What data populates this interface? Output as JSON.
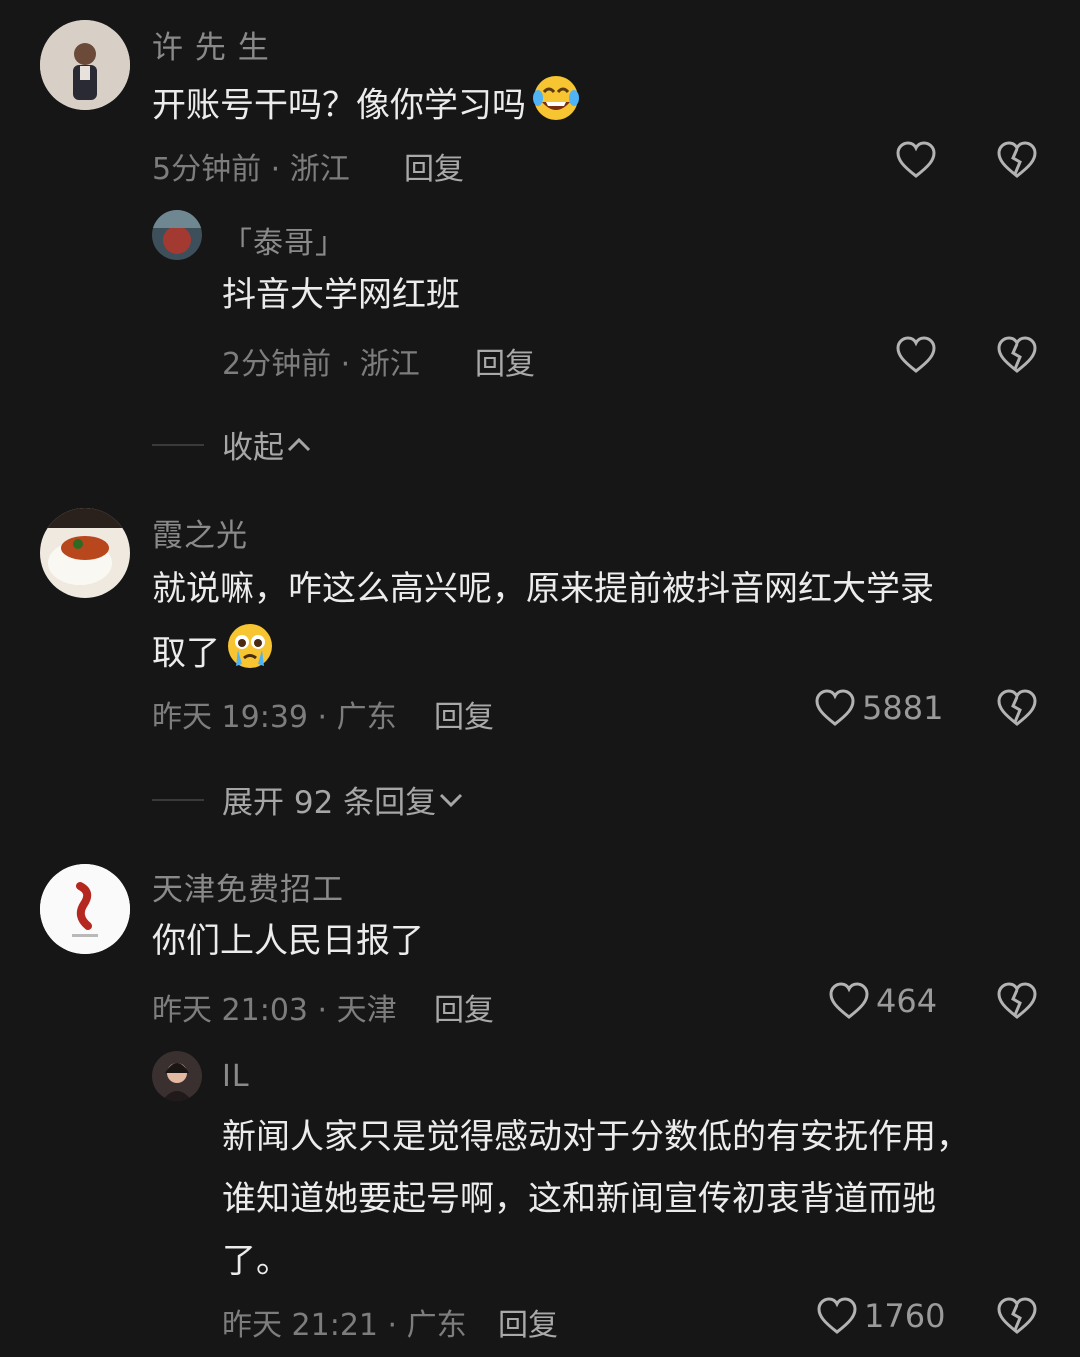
{
  "comments": [
    {
      "user": "许 先 生",
      "text": "开账号干吗？像你学习吗",
      "emoji": "laughing-tears-emoji",
      "time_loc": "5分钟前 · 浙江",
      "reply_label": "回复",
      "likes": "",
      "replies": [
        {
          "user": "「泰哥」",
          "text": "抖音大学网红班",
          "time_loc": "2分钟前 · 浙江",
          "reply_label": "回复"
        }
      ],
      "expand_label": "收起"
    },
    {
      "user": "霞之光",
      "text_line1": "就说嘛，咋这么高兴呢，原来提前被抖音网红大学录",
      "text_line2": "取了",
      "emoji": "pleading-tears-emoji",
      "time_loc": "昨天 19:39 · 广东",
      "reply_label": "回复",
      "likes": "5881",
      "expand_label": "展开 92 条回复"
    },
    {
      "user": "天津免费招工",
      "text": "你们上人民日报了",
      "time_loc": "昨天 21:03 · 天津",
      "reply_label": "回复",
      "likes": "464",
      "replies": [
        {
          "user": "IL",
          "text_line1": "新闻人家只是觉得感动对于分数低的有安抚作用，",
          "text_line2": "谁知道她要起号啊，这和新闻宣传初衷背道而驰",
          "text_line3": "了。",
          "time_loc": "昨天 21:21 · 广东",
          "reply_label": "回复",
          "likes": "1760"
        }
      ]
    }
  ],
  "icons": {
    "like": "heart-outline-icon",
    "dislike": "broken-heart-icon",
    "collapse": "chevron-up-icon",
    "expand": "chevron-down-icon"
  },
  "colors": {
    "background": "#161616",
    "text": "#ececec",
    "meta": "#7d7d7d"
  }
}
